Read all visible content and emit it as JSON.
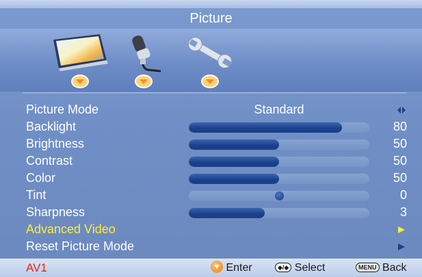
{
  "menu": {
    "title": "Picture"
  },
  "categories": [
    {
      "name": "picture",
      "icon": "monitor-icon",
      "active": true
    },
    {
      "name": "audio",
      "icon": "microphone-icon",
      "active": false
    },
    {
      "name": "settings",
      "icon": "wrench-icon",
      "active": false
    }
  ],
  "rows": [
    {
      "label": "Picture Mode",
      "value": "Standard",
      "control": "selector"
    },
    {
      "label": "Backlight",
      "value": "80",
      "control": "slider",
      "level": 0.85
    },
    {
      "label": "Brightness",
      "value": "50",
      "control": "slider",
      "level": 0.5
    },
    {
      "label": "Contrast",
      "value": "50",
      "control": "slider",
      "level": 0.5
    },
    {
      "label": "Color",
      "value": "50",
      "control": "slider",
      "level": 0.5
    },
    {
      "label": "Tint",
      "value": "0",
      "control": "center-slider",
      "level": 0.5
    },
    {
      "label": "Sharpness",
      "value": "3",
      "control": "slider",
      "level": 0.42
    },
    {
      "label": "Advanced Video",
      "control": "submenu",
      "highlighted": true
    },
    {
      "label": "Reset Picture Mode",
      "control": "submenu",
      "highlighted": false
    }
  ],
  "footer": {
    "source": "AV1",
    "enter_label": "Enter",
    "select_key": "◆/◆",
    "select_label": "Select",
    "menu_key": "MENU",
    "back_label": "Back"
  },
  "colors": {
    "highlight_text": "#ffec3a",
    "source_text": "#e0251b",
    "bar_fill": "#18408c",
    "arrow_active": "#ffec3a",
    "arrow_normal": "#1f3f86"
  }
}
